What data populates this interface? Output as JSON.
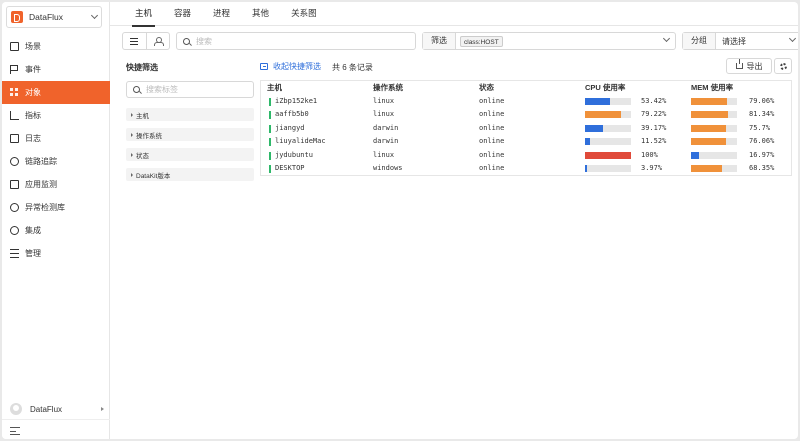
{
  "app": {
    "workspace_name": "DataFlux",
    "user_name": "DataFlux",
    "accent": "#f0632b"
  },
  "sidebar": {
    "items": [
      {
        "label": "场景",
        "icon": "scene-icon",
        "active": false
      },
      {
        "label": "事件",
        "icon": "flag-icon",
        "active": false
      },
      {
        "label": "对象",
        "icon": "grid-icon",
        "active": true
      },
      {
        "label": "指标",
        "icon": "chart-icon",
        "active": false
      },
      {
        "label": "日志",
        "icon": "calendar-icon",
        "active": false
      },
      {
        "label": "链路追踪",
        "icon": "trace-icon",
        "active": false
      },
      {
        "label": "应用监测",
        "icon": "monitor-icon",
        "active": false
      },
      {
        "label": "异常检测库",
        "icon": "alert-icon",
        "active": false
      },
      {
        "label": "集成",
        "icon": "cube-icon",
        "active": false
      },
      {
        "label": "管理",
        "icon": "settings-sliders-icon",
        "active": false
      }
    ]
  },
  "tabs": [
    {
      "label": "主机",
      "active": true
    },
    {
      "label": "容器",
      "active": false
    },
    {
      "label": "进程",
      "active": false
    },
    {
      "label": "其他",
      "active": false
    },
    {
      "label": "关系图",
      "active": false
    }
  ],
  "toolbar": {
    "search_placeholder": "搜索",
    "filter_label": "筛选",
    "filter_chip": "class:HOST",
    "group_label": "分组",
    "group_value": "请选择"
  },
  "quick_filter": {
    "title": "快捷筛选",
    "search_placeholder": "搜索标签",
    "groups": [
      "主机",
      "操作系统",
      "状态",
      "DataKit版本"
    ]
  },
  "list": {
    "collapse_label": "收起快捷筛选",
    "total_label": "共 6 条记录",
    "export_label": "导出",
    "columns": [
      "主机",
      "操作系统",
      "状态",
      "CPU 使用率",
      "MEM 使用率"
    ],
    "rows": [
      {
        "host": "iZbp152ke1",
        "os": "linux",
        "status": "online",
        "cpu": 53.42,
        "cpu_text": "53.42%",
        "mem": 79.06,
        "mem_text": "79.06%"
      },
      {
        "host": "aaffb5b0",
        "os": "linux",
        "status": "online",
        "cpu": 79.22,
        "cpu_text": "79.22%",
        "mem": 81.34,
        "mem_text": "81.34%"
      },
      {
        "host": "jiangyd",
        "os": "darwin",
        "status": "online",
        "cpu": 39.17,
        "cpu_text": "39.17%",
        "mem": 75.7,
        "mem_text": "75.7%"
      },
      {
        "host": "liuyalideMac",
        "os": "darwin",
        "status": "online",
        "cpu": 11.52,
        "cpu_text": "11.52%",
        "mem": 76.06,
        "mem_text": "76.06%"
      },
      {
        "host": "jydubuntu",
        "os": "linux",
        "status": "online",
        "cpu": 100,
        "cpu_text": "100%",
        "mem": 16.97,
        "mem_text": "16.97%"
      },
      {
        "host": "DESKTOP",
        "os": "windows",
        "status": "online",
        "cpu": 3.97,
        "cpu_text": "3.97%",
        "mem": 68.35,
        "mem_text": "68.35%"
      }
    ],
    "colors": {
      "blue": "#2f6fdb",
      "orange": "#f0913a",
      "red": "#e04a3a",
      "online": "#2fb86a"
    }
  }
}
